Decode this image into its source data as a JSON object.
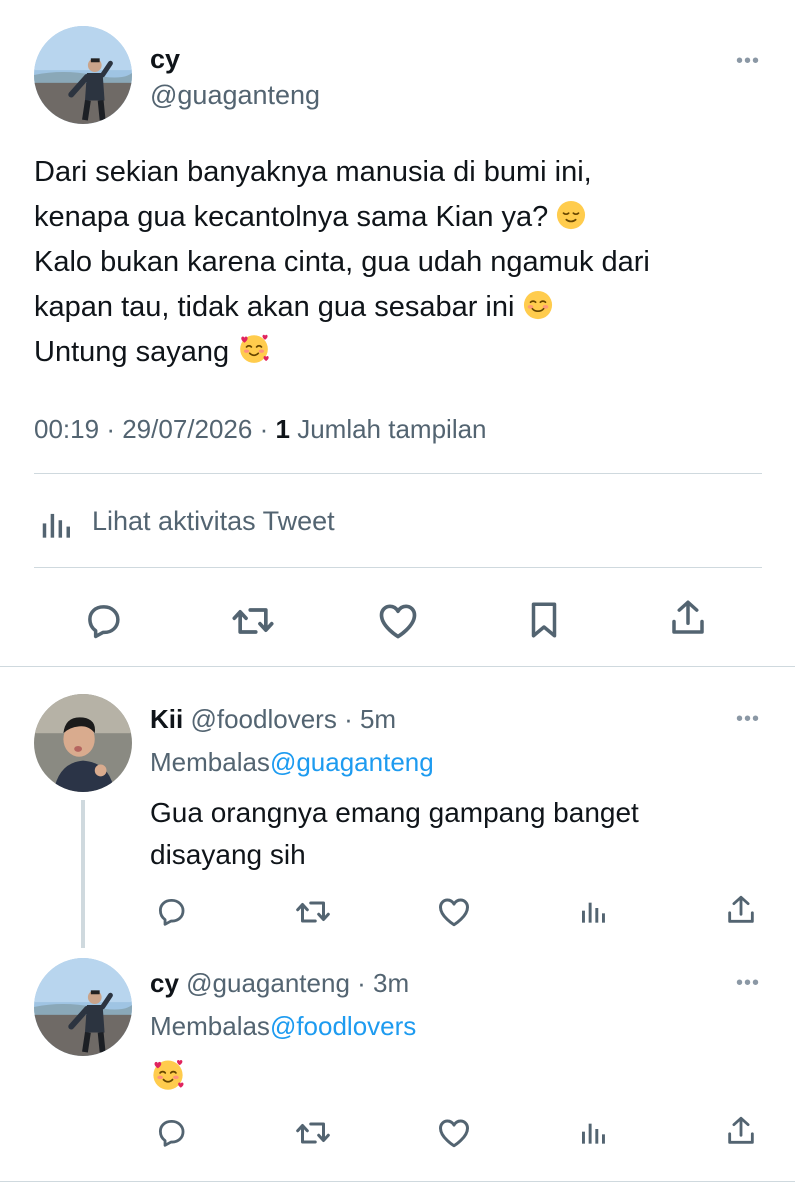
{
  "main_tweet": {
    "display_name": "cy",
    "handle": "@guaganteng",
    "lines": [
      "Dari sekian banyaknya manusia di bumi ini,",
      "kenapa gua kecantolnya sama Kian ya?",
      "Kalo bukan karena cinta, gua udah ngamuk dari",
      "kapan tau, tidak akan gua sesabar ini",
      "Untung sayang"
    ],
    "time": "00:19",
    "date": "29/07/2026",
    "separator": "·",
    "views_count": "1",
    "views_label": "Jumlah tampilan",
    "activity_label": "Lihat aktivitas Tweet"
  },
  "replies": [
    {
      "display_name": "Kii",
      "handle": "@foodlovers",
      "age": "· 5m",
      "replying_label": "Membalas",
      "replying_to": "@guaganteng",
      "lines": [
        "Gua orangnya emang gampang banget",
        "disayang sih"
      ]
    },
    {
      "display_name": "cy",
      "handle": "@guaganteng",
      "age": "· 3m",
      "replying_label": "Membalas",
      "replying_to": "@foodlovers",
      "lines": []
    }
  ],
  "more_glyph": "•••",
  "icons": {
    "reply": "reply-icon",
    "retweet": "retweet-icon",
    "like": "heart-icon",
    "bookmark": "bookmark-icon",
    "share": "share-icon",
    "analytics": "analytics-icon",
    "emoji_relieved": "relieved-face-emoji",
    "emoji_smiling": "smiling-face-emoji",
    "emoji_hearts": "smiling-face-with-hearts-emoji"
  },
  "colors": {
    "text": "#0f1419",
    "muted": "#536471",
    "link": "#1d9bf0",
    "divider": "#cfd9de"
  }
}
